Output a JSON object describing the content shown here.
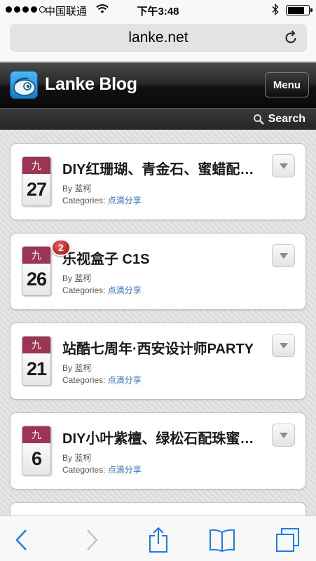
{
  "status_bar": {
    "carrier": "中国联通",
    "time": "下午3:48",
    "signal_bars_filled": 4,
    "signal_bars_total": 5,
    "battery_level": 0.82
  },
  "browser": {
    "url": "lanke.net",
    "reload_icon": "reload-icon"
  },
  "site": {
    "title": "Lanke Blog",
    "menu_label": "Menu",
    "search_label": "Search",
    "accent_color": "#9c3553"
  },
  "posts": [
    {
      "month": "九",
      "day": "27",
      "title": "DIY红珊瑚、青金石、蜜蜡配珠手串",
      "by_prefix": "By ",
      "author": "蓝柯",
      "categories_label": "Categories: ",
      "category": "点滴分享",
      "comments": ""
    },
    {
      "month": "九",
      "day": "26",
      "title": "乐视盒子 C1S",
      "by_prefix": "By ",
      "author": "蓝柯",
      "categories_label": "Categories: ",
      "category": "点滴分享",
      "comments": "2"
    },
    {
      "month": "九",
      "day": "21",
      "title": "站酷七周年·西安设计师PARTY",
      "by_prefix": "By ",
      "author": "蓝柯",
      "categories_label": "Categories: ",
      "category": "点滴分享",
      "comments": ""
    },
    {
      "month": "九",
      "day": "6",
      "title": "DIY小叶紫檀、绿松石配珠蜜蜡手串",
      "by_prefix": "By ",
      "author": "蓝柯",
      "categories_label": "Categories: ",
      "category": "点滴分享",
      "comments": ""
    }
  ],
  "toolbar": {
    "icons": [
      "back-icon",
      "forward-icon",
      "share-icon",
      "bookmarks-icon",
      "tabs-icon"
    ],
    "tint_color": "#1a7cf0",
    "disabled_color": "#c4c4c4"
  }
}
